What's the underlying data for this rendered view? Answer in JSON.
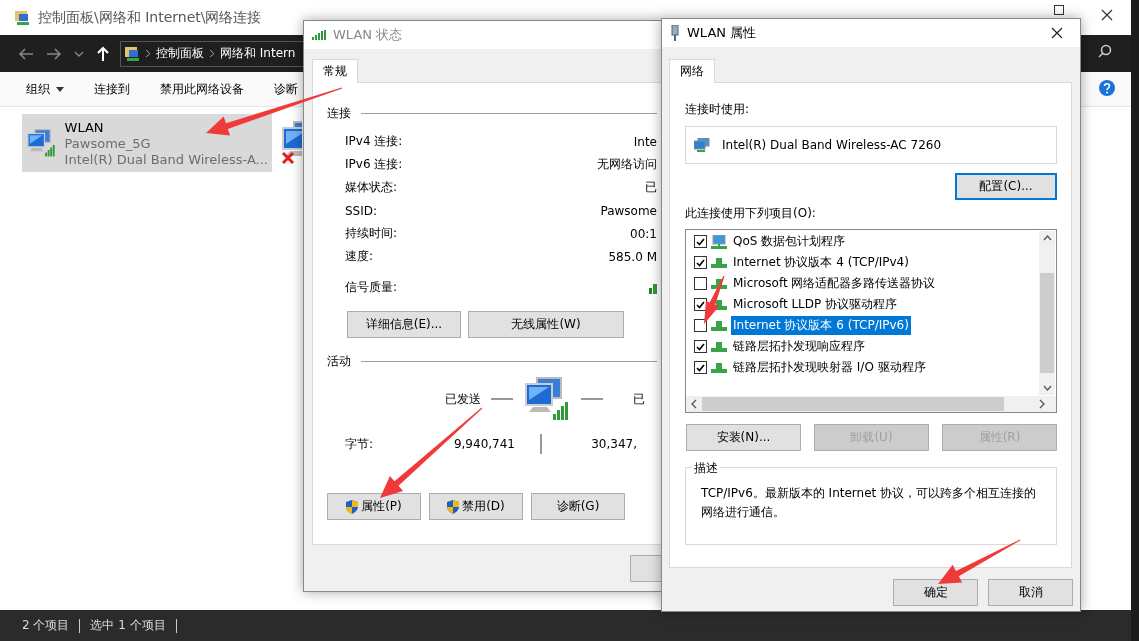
{
  "explorer": {
    "title": "控制面板\\网络和 Internet\\网络连接",
    "breadcrumbs": [
      "控制面板",
      "网络和 Intern"
    ],
    "toolbar": [
      {
        "label": "组织",
        "kind": "menu"
      },
      {
        "label": "连接到",
        "kind": "plain"
      },
      {
        "label": "禁用此网络设备",
        "kind": "plain"
      },
      {
        "label": "诊断",
        "kind": "plain"
      }
    ],
    "items": [
      {
        "name": "WLAN",
        "network": "Pawsome_5G",
        "adapter": "Intel(R) Dual Band Wireless-A...",
        "selected": true,
        "connected": true
      },
      {
        "selected": false,
        "connected": false
      }
    ],
    "status_bar": [
      "2 个项目",
      "选中 1 个项目"
    ]
  },
  "status_dialog": {
    "title": "WLAN 状态",
    "tabs": [
      {
        "label": "常规",
        "selected": true
      }
    ],
    "connection_heading": "连接",
    "fields": [
      {
        "label": "IPv4 连接:",
        "value": "Inte"
      },
      {
        "label": "IPv6 连接:",
        "value": "无网络访问"
      },
      {
        "label": "媒体状态:",
        "value": "已"
      },
      {
        "label": "SSID:",
        "value": "Pawsome"
      },
      {
        "label": "持续时间:",
        "value": "00:1"
      },
      {
        "label": "速度:",
        "value": "585.0 M"
      }
    ],
    "signal_label": "信号质量:",
    "detail_buttons": [
      "详细信息(E)...",
      "无线属性(W)"
    ],
    "activity_heading": "活动",
    "sent_label": "已发送",
    "received_label": "已",
    "bytes_label": "字节:",
    "bytes_sent": "9,940,741",
    "bytes_received": "30,347,",
    "actions": [
      {
        "label": "属性(P)",
        "shield": true
      },
      {
        "label": "禁用(D)",
        "shield": true
      },
      {
        "label": "诊断(G)",
        "shield": false
      }
    ]
  },
  "properties_dialog": {
    "title": "WLAN 属性",
    "tabs": [
      {
        "label": "网络",
        "selected": true
      }
    ],
    "connect_using_label": "连接时使用:",
    "adapter": "Intel(R) Dual Band Wireless-AC 7260",
    "configure_button": "配置(C)...",
    "items_label": "此连接使用下列项目(O):",
    "components": [
      {
        "label": "QoS 数据包计划程序",
        "checked": true,
        "selected": false,
        "kind": "service"
      },
      {
        "label": "Internet 协议版本 4 (TCP/IPv4)",
        "checked": true,
        "selected": false,
        "kind": "protocol"
      },
      {
        "label": "Microsoft 网络适配器多路传送器协议",
        "checked": false,
        "selected": false,
        "kind": "protocol"
      },
      {
        "label": "Microsoft LLDP 协议驱动程序",
        "checked": true,
        "selected": false,
        "kind": "protocol"
      },
      {
        "label": "Internet 协议版本 6 (TCP/IPv6)",
        "checked": false,
        "selected": true,
        "kind": "protocol"
      },
      {
        "label": "链路层拓扑发现响应程序",
        "checked": true,
        "selected": false,
        "kind": "protocol"
      },
      {
        "label": "链路层拓扑发现映射器 I/O 驱动程序",
        "checked": true,
        "selected": false,
        "kind": "protocol"
      }
    ],
    "buttons": [
      {
        "label": "安装(N)...",
        "disabled": false
      },
      {
        "label": "卸载(U)",
        "disabled": true
      },
      {
        "label": "属性(R)",
        "disabled": true
      }
    ],
    "description_heading": "描述",
    "description": "TCP/IPv6。最新版本的 Internet 协议，可以跨多个相互连接的网络进行通信。",
    "ok_button": "确定",
    "cancel_button": "取消"
  }
}
